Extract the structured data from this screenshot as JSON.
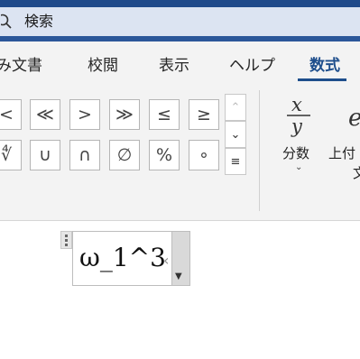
{
  "title_bar": {
    "search_label": "検索"
  },
  "ribbon_tabs": [
    {
      "label": "み文書",
      "active": false
    },
    {
      "label": "校閲",
      "active": false
    },
    {
      "label": "表示",
      "active": false
    },
    {
      "label": "ヘルプ",
      "active": false
    },
    {
      "label": "数式",
      "active": true
    }
  ],
  "symbols": {
    "row1": [
      "<",
      "≪",
      ">",
      "≫",
      "≤",
      "≥"
    ],
    "row2": [
      "∜",
      "∪",
      "∩",
      "∅",
      "%",
      "∘"
    ]
  },
  "structures": {
    "fraction_label": "分数",
    "superscript_label": "上付",
    "superscript_label_2": "文"
  },
  "equation": {
    "text": "ω_1^3"
  },
  "colors": {
    "title_bar": "#2b579a",
    "accent": "#1e4e8c",
    "ribbon_bg": "#f3f3f3"
  }
}
